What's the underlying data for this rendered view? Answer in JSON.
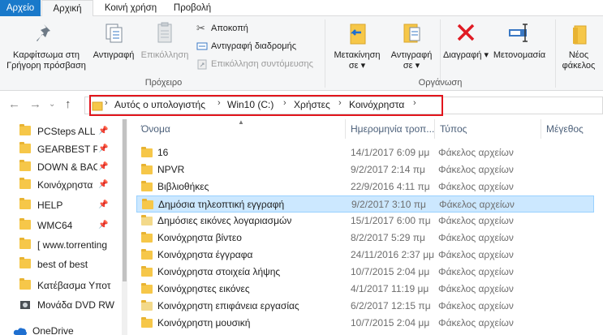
{
  "ribbon_tabs": [
    "Αρχείο",
    "Αρχική",
    "Κοινή χρήση",
    "Προβολή"
  ],
  "clipboard": {
    "pin_label_1": "Καρφίτσωμα στη",
    "pin_label_2": "Γρήγορη πρόσβαση",
    "copy_label": "Αντιγραφή",
    "paste_label": "Επικόλληση",
    "cut_label": "Αποκοπή",
    "copy_path_label": "Αντιγραφή διαδρομής",
    "paste_shortcut_label": "Επικόλληση συντόμευσης",
    "group_label": "Πρόχειρο"
  },
  "organize": {
    "move_label_1": "Μετακίνηση",
    "move_label_2": "σε",
    "copyto_label_1": "Αντιγραφή",
    "copyto_label_2": "σε",
    "delete_label": "Διαγραφή",
    "rename_label": "Μετονομασία",
    "group_label": "Οργάνωση"
  },
  "new_group": {
    "new_folder_label_1": "Νέος",
    "new_folder_label_2": "φάκελος"
  },
  "address_bar": {
    "crumbs": [
      "Αυτός ο υπολογιστής",
      "Win10 (C:)",
      "Χρήστες",
      "Κοινόχρηστα"
    ]
  },
  "nav_pane": {
    "items": [
      {
        "label": "PCSteps ALL",
        "pinned": true
      },
      {
        "label": "GEARBEST PC",
        "pinned": true
      },
      {
        "label": "DOWN & BAC",
        "pinned": true
      },
      {
        "label": "Κοινόχρηστα",
        "pinned": true
      },
      {
        "label": "HELP",
        "pinned": true
      },
      {
        "label": "WMC64",
        "pinned": true
      },
      {
        "label": "[ www.torrenting",
        "pinned": false
      },
      {
        "label": "best of best",
        "pinned": false
      },
      {
        "label": "Κατέβασμα Υποτ",
        "pinned": false
      },
      {
        "label": "Μονάδα DVD RW",
        "pinned": false
      },
      {
        "label": "OneDrive",
        "pinned": false
      }
    ]
  },
  "file_list": {
    "columns": [
      "Όνομα",
      "Ημερομηνία τροπ...",
      "Τύπος",
      "Μέγεθος"
    ],
    "rows": [
      {
        "name": "16",
        "date": "14/1/2017 6:09 μμ",
        "type": "Φάκελος αρχείων",
        "selected": false
      },
      {
        "name": "NPVR",
        "date": "9/2/2017 2:14 πμ",
        "type": "Φάκελος αρχείων",
        "selected": false
      },
      {
        "name": "Βιβλιοθήκες",
        "date": "22/9/2016 4:11 πμ",
        "type": "Φάκελος αρχείων",
        "selected": false
      },
      {
        "name": "Δημόσια τηλεοπτική εγγραφή",
        "date": "9/2/2017 3:10 πμ",
        "type": "Φάκελος αρχείων",
        "selected": true
      },
      {
        "name": "Δημόσιες εικόνες λογαριασμών",
        "date": "15/1/2017 6:00 πμ",
        "type": "Φάκελος αρχείων",
        "selected": false
      },
      {
        "name": "Κοινόχρηστα βίντεο",
        "date": "8/2/2017 5:29 πμ",
        "type": "Φάκελος αρχείων",
        "selected": false
      },
      {
        "name": "Κοινόχρηστα έγγραφα",
        "date": "24/11/2016 2:37 μμ",
        "type": "Φάκελος αρχείων",
        "selected": false
      },
      {
        "name": "Κοινόχρηστα στοιχεία λήψης",
        "date": "10/7/2015 2:04 μμ",
        "type": "Φάκελος αρχείων",
        "selected": false
      },
      {
        "name": "Κοινόχρηστες εικόνες",
        "date": "4/1/2017 11:19 μμ",
        "type": "Φάκελος αρχείων",
        "selected": false
      },
      {
        "name": "Κοινόχρηστη επιφάνεια εργασίας",
        "date": "6/2/2017 12:15 πμ",
        "type": "Φάκελος αρχείων",
        "selected": false
      },
      {
        "name": "Κοινόχρηστη μουσική",
        "date": "10/7/2015 2:04 μμ",
        "type": "Φάκελος αρχείων",
        "selected": false
      }
    ]
  },
  "colors": {
    "accent": "#1979ca",
    "highlight_border": "#e2151c",
    "selection": "#cce8ff",
    "folder": "#f6c749"
  }
}
